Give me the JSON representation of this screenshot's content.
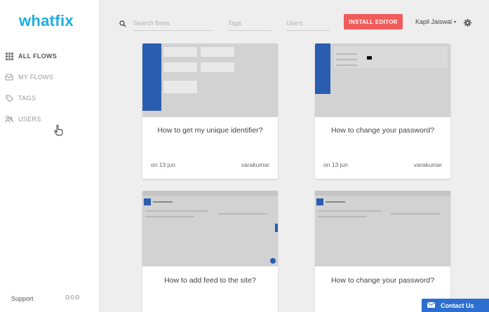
{
  "app": {
    "logo": "whatfix"
  },
  "sidebar": {
    "items": [
      {
        "label": "ALL FLOWS",
        "icon": "grid-icon",
        "active": true
      },
      {
        "label": "MY FLOWS",
        "icon": "inbox-icon",
        "active": false
      },
      {
        "label": "TAGS",
        "icon": "tag-icon",
        "active": false
      },
      {
        "label": "USERS",
        "icon": "users-icon",
        "active": false
      }
    ],
    "support_label": "Support",
    "more_label": "ooo"
  },
  "header": {
    "search_placeholder": "Search flows",
    "tags_placeholder": "Tags",
    "users_placeholder": "Users",
    "install_label": "INSTALL EDITOR",
    "user_name": "Kapil Jaiswal",
    "user_caret": "▾"
  },
  "cards": [
    {
      "title": "How to get my unique identifier?",
      "date": "on 13 jun",
      "author": "varakumar"
    },
    {
      "title": "How to change your password?",
      "date": "on 13 jun",
      "author": "varakumar"
    },
    {
      "title": "How to add feed to the site?",
      "date": "",
      "author": ""
    },
    {
      "title": "How to change your password?",
      "date": "",
      "author": ""
    }
  ],
  "contact": {
    "label": "Contact Us"
  },
  "colors": {
    "accent": "#1dade1",
    "install": "#f05b5b",
    "contact": "#2c6fcf",
    "thumb_blue": "#2a5db0"
  }
}
